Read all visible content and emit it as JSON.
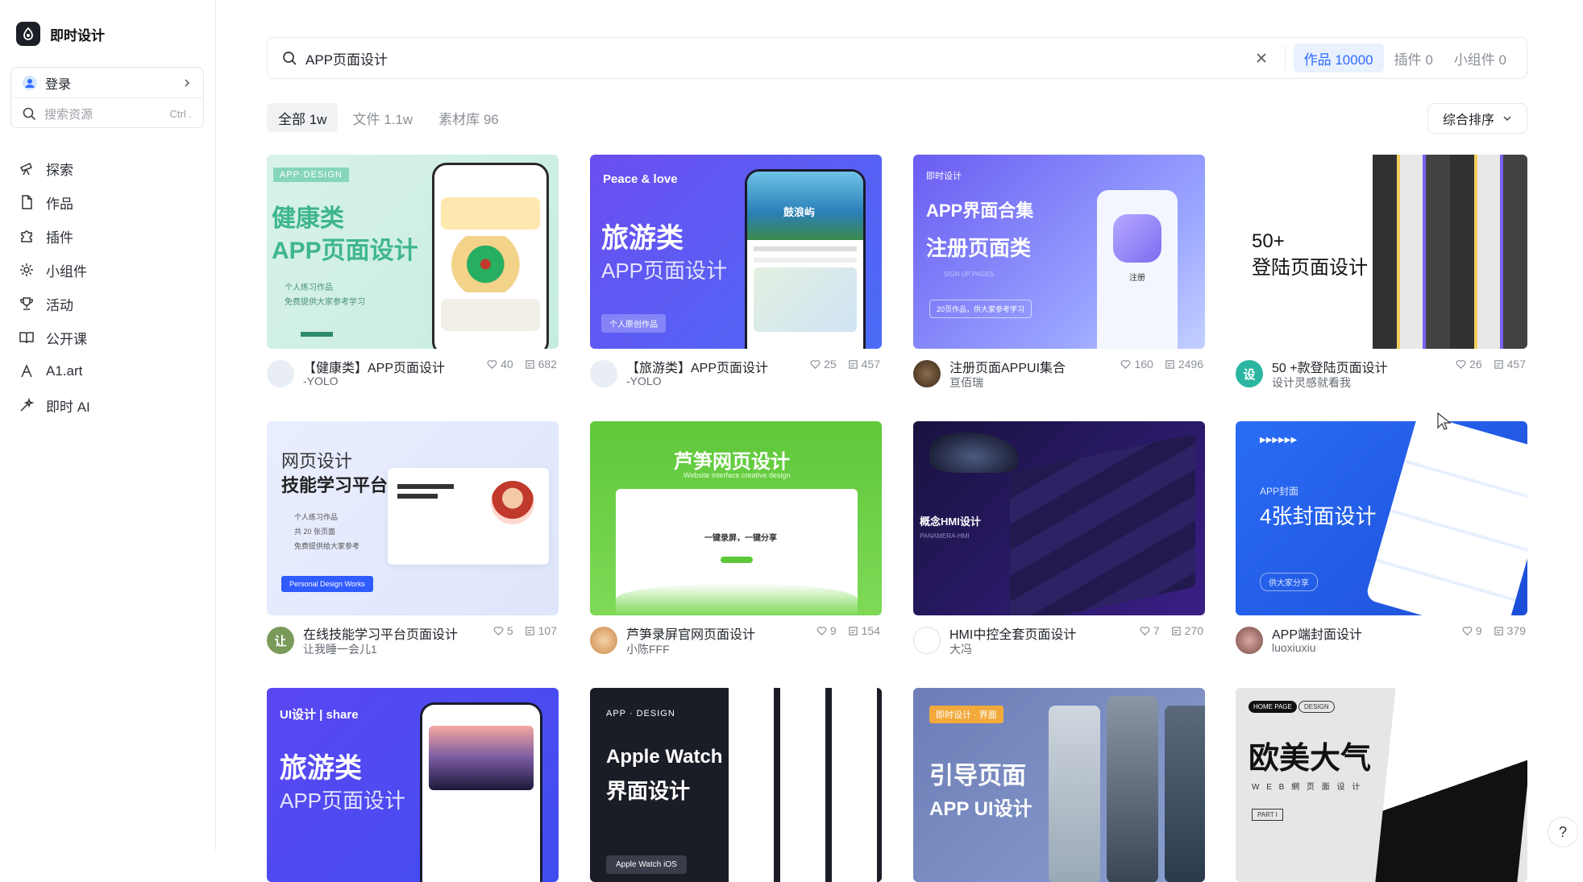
{
  "brand": {
    "name": "即时设计"
  },
  "sidebar": {
    "login_label": "登录",
    "search_placeholder": "搜索资源",
    "search_shortcut": "Ctrl .",
    "items": [
      {
        "label": "探索",
        "icon": "telescope-icon"
      },
      {
        "label": "作品",
        "icon": "file-icon"
      },
      {
        "label": "插件",
        "icon": "puzzle-icon"
      },
      {
        "label": "小组件",
        "icon": "gear-icon"
      },
      {
        "label": "活动",
        "icon": "trophy-icon"
      },
      {
        "label": "公开课",
        "icon": "book-icon"
      },
      {
        "label": "A1.art",
        "icon": "pen-icon"
      },
      {
        "label": "即时 AI",
        "icon": "sparkle-icon"
      }
    ]
  },
  "search": {
    "query": "APP页面设计",
    "tabs": [
      {
        "label": "作品 10000",
        "active": true
      },
      {
        "label": "插件 0",
        "active": false
      },
      {
        "label": "小组件 0",
        "active": false
      }
    ]
  },
  "filters": [
    {
      "label": "全部 1w",
      "active": true
    },
    {
      "label": "文件 1.1w",
      "active": false
    },
    {
      "label": "素材库 96",
      "active": false
    }
  ],
  "sort_label": "综合排序",
  "cards": [
    {
      "title": "【健康类】APP页面设计",
      "author": "-YOLO",
      "likes": "40",
      "views": "682",
      "thumb": {
        "tag": "APP·DESIGN",
        "line1": "健康类",
        "line2": "APP页面设计",
        "b1": "个人练习作品",
        "b2": "免费提供大家参考学习"
      }
    },
    {
      "title": "【旅游类】APP页面设计",
      "author": "-YOLO",
      "likes": "25",
      "views": "457",
      "thumb": {
        "tag": "Peace & love",
        "line1": "旅游类",
        "line2": "APP页面设计",
        "badge": "个人原创作品",
        "phone": "鼓浪屿"
      }
    },
    {
      "title": "注册页面APPUI集合",
      "author": "亘佰瑞",
      "likes": "160",
      "views": "2496",
      "thumb": {
        "tag": "即时设计",
        "line1": "APP界面合集",
        "line2": "注册页面类",
        "sub": "SIGN UP PAGES",
        "badge": "20页作品，供大家参考学习",
        "btn": "注册"
      }
    },
    {
      "title": "50 +款登陆页面设计",
      "author": "设计灵感就看我",
      "likes": "26",
      "views": "457",
      "avatar_text": "设",
      "thumb": {
        "line1": "50+",
        "line2": "登陆页面设计"
      }
    },
    {
      "title": "在线技能学习平台页面设计",
      "author": "让我睡一会儿1",
      "likes": "5",
      "views": "107",
      "avatar_text": "让",
      "thumb": {
        "line1": "网页设计",
        "line2": "技能学习平台",
        "b1": "个人练习作品",
        "b2": "共 20 张页面",
        "b3": "免费提供给大家参考",
        "btn": "Personal Design Works"
      }
    },
    {
      "title": "芦笋录屏官网页面设计",
      "author": "小陈FFF",
      "likes": "9",
      "views": "154",
      "thumb": {
        "line1": "芦笋网页设计",
        "sub": "Website interface creative design",
        "mid": "一键录屏，一键分享"
      }
    },
    {
      "title": "HMI中控全套页面设计",
      "author": "大冯",
      "likes": "7",
      "views": "270",
      "thumb": {
        "line1": "概念HMI设计",
        "sub": "PANAMERA-HMI"
      }
    },
    {
      "title": "APP端封面设计",
      "author": "luoxiuxiu",
      "likes": "9",
      "views": "379",
      "thumb": {
        "tag": "▶▶▶▶▶▶",
        "line1": "APP封面",
        "line2": "4张封面设计",
        "badge": "供大家分享"
      }
    },
    {
      "title": "",
      "author": "",
      "likes": "",
      "views": "",
      "thumb": {
        "tag": "UI设计 | share",
        "line1": "旅游类",
        "line2": "APP页面设计"
      }
    },
    {
      "title": "",
      "author": "",
      "likes": "",
      "views": "",
      "thumb": {
        "tag": "APP · DESIGN",
        "line1": "Apple Watch",
        "line2": "界面设计",
        "badge": "Apple Watch iOS"
      }
    },
    {
      "title": "",
      "author": "",
      "likes": "",
      "views": "",
      "thumb": {
        "tag": "即时设计 · 界面",
        "line1": "引导页面",
        "line2": "APP UI设计"
      }
    },
    {
      "title": "",
      "author": "",
      "likes": "",
      "views": "",
      "thumb": {
        "tag": "HOME PAGE",
        "tag2": "DESIGN",
        "line1": "欧美大气",
        "line2": "W E B 網 页 面 设 计",
        "badge": "PART I"
      }
    }
  ],
  "help_label": "?"
}
